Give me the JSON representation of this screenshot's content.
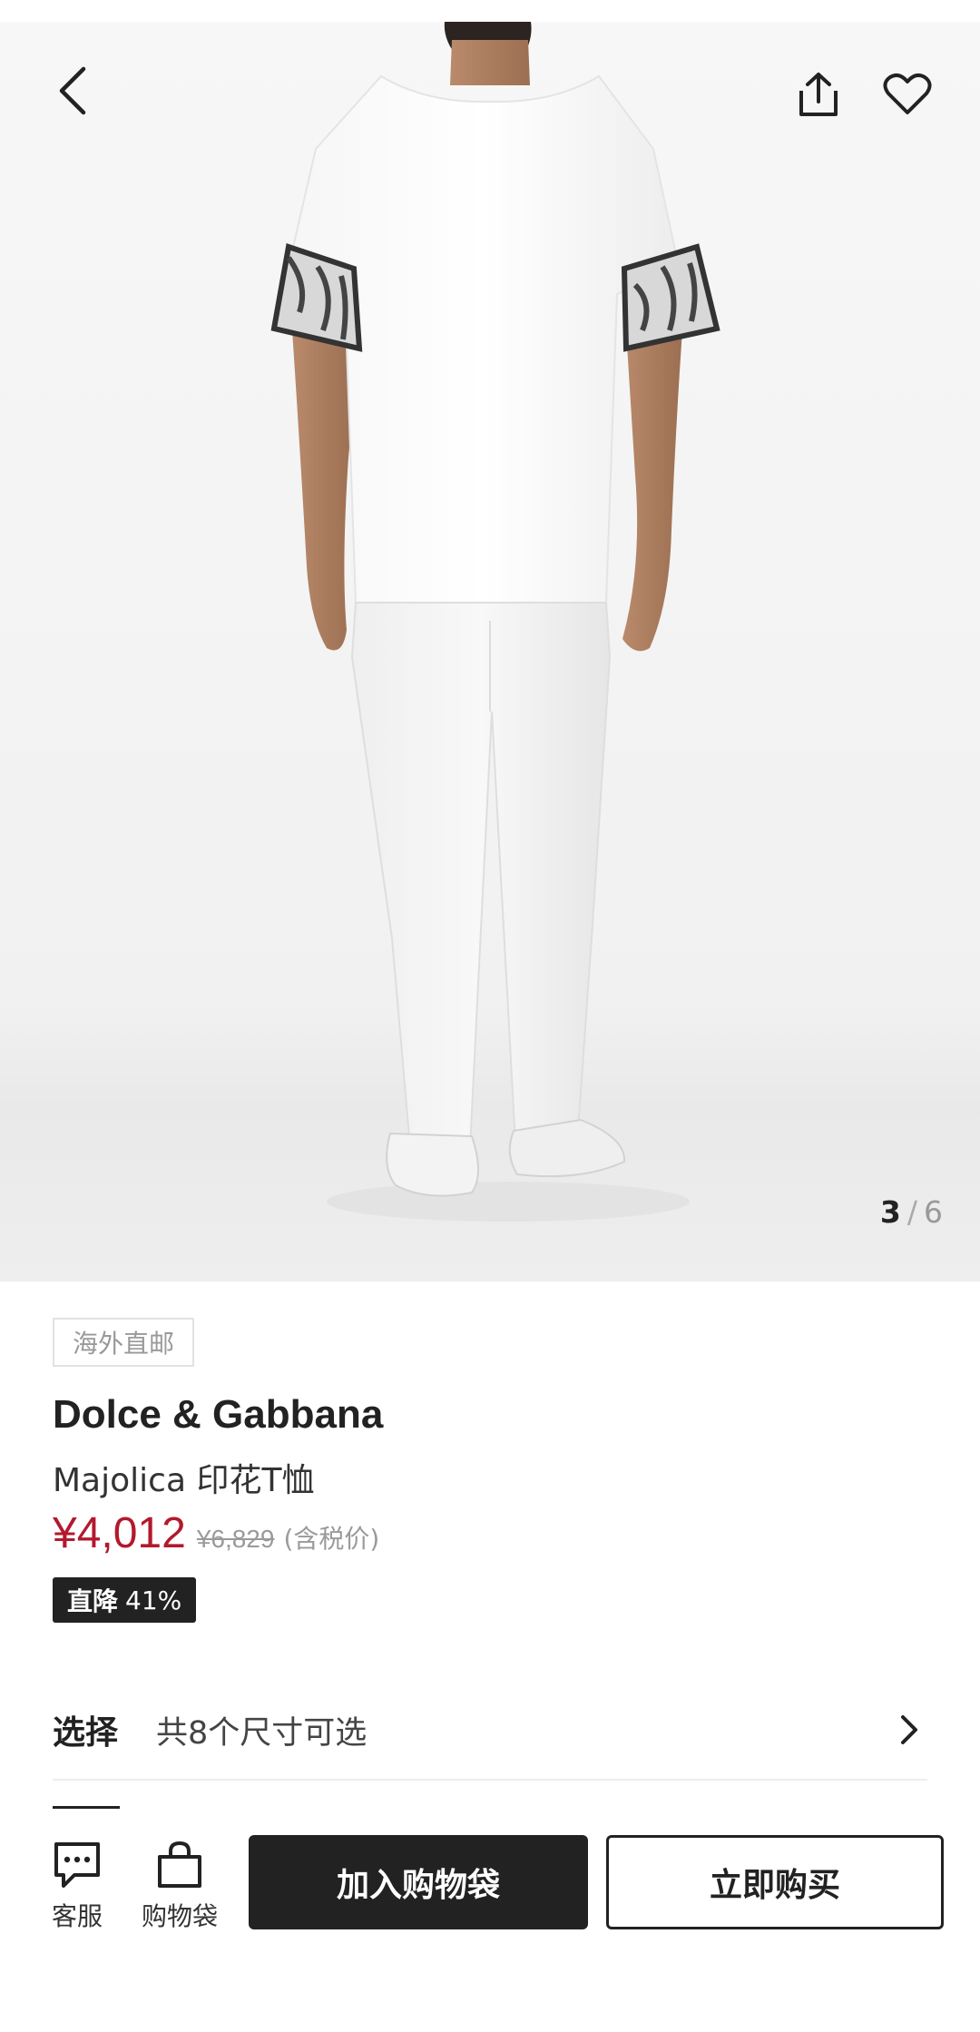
{
  "gallery": {
    "current": "3",
    "separator": "/",
    "total": "6",
    "image_alt": "model-back-view"
  },
  "icons": {
    "back": "back-arrow-icon",
    "share": "share-icon",
    "favorite": "heart-icon",
    "chevron": "chevron-right-icon",
    "customer_service": "chat-bubble-icon",
    "bag": "shopping-bag-icon"
  },
  "product": {
    "tag": "海外直邮",
    "brand": "Dolce & Gabbana",
    "name": "Majolica 印花T恤",
    "price": "¥4,012",
    "original_price": "¥6,829",
    "tax_note": "(含税价)",
    "discount_label": "直降",
    "discount_value": "41%"
  },
  "selection": {
    "title": "选择",
    "value": "共8个尺寸可选"
  },
  "bottom_bar": {
    "customer_service": "客服",
    "bag": "购物袋",
    "add_to_cart": "加入购物袋",
    "buy_now": "立即购买"
  },
  "colors": {
    "price": "#b3192d",
    "dark": "#222222",
    "muted": "#999999"
  }
}
